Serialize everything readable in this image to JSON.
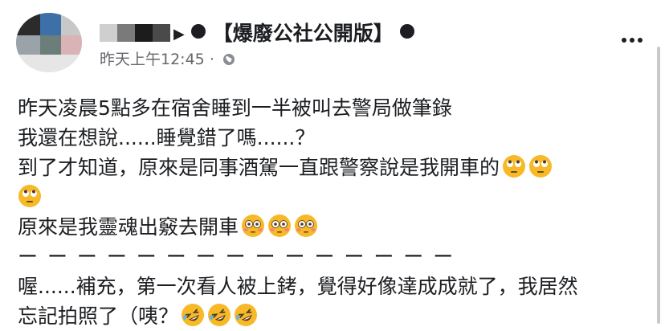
{
  "post": {
    "author_blurred": "",
    "arrow": "▶",
    "group_name": "【爆廢公社公開版】",
    "timestamp": "昨天上午12:45",
    "separator": "·",
    "lines": [
      "昨天凌晨5點多在宿舍睡到一半被叫去警局做筆錄",
      "我還在想說......睡覺錯了嗎......？",
      "到了才知道，原來是同事酒駕一直跟警察說是我開車的",
      "",
      "原來是我靈魂出竅去開車",
      "ー ー ー ー ー ー ー ー ー ー ー ー ー ー ー",
      "喔......補充，第一次看人被上銬，覺得好像達成成就了，我居然",
      "忘記拍照了（咦？"
    ]
  },
  "icons": {
    "globe": "globe-icon",
    "more": "more-options-icon",
    "eyeroll": "face-with-rolling-eyes-emoji",
    "flushed": "flushed-face-emoji",
    "rofl": "rolling-on-floor-laughing-emoji"
  },
  "colors": {
    "text": "#1c1e21",
    "meta": "#65676b",
    "emoji": "#f7b928"
  }
}
